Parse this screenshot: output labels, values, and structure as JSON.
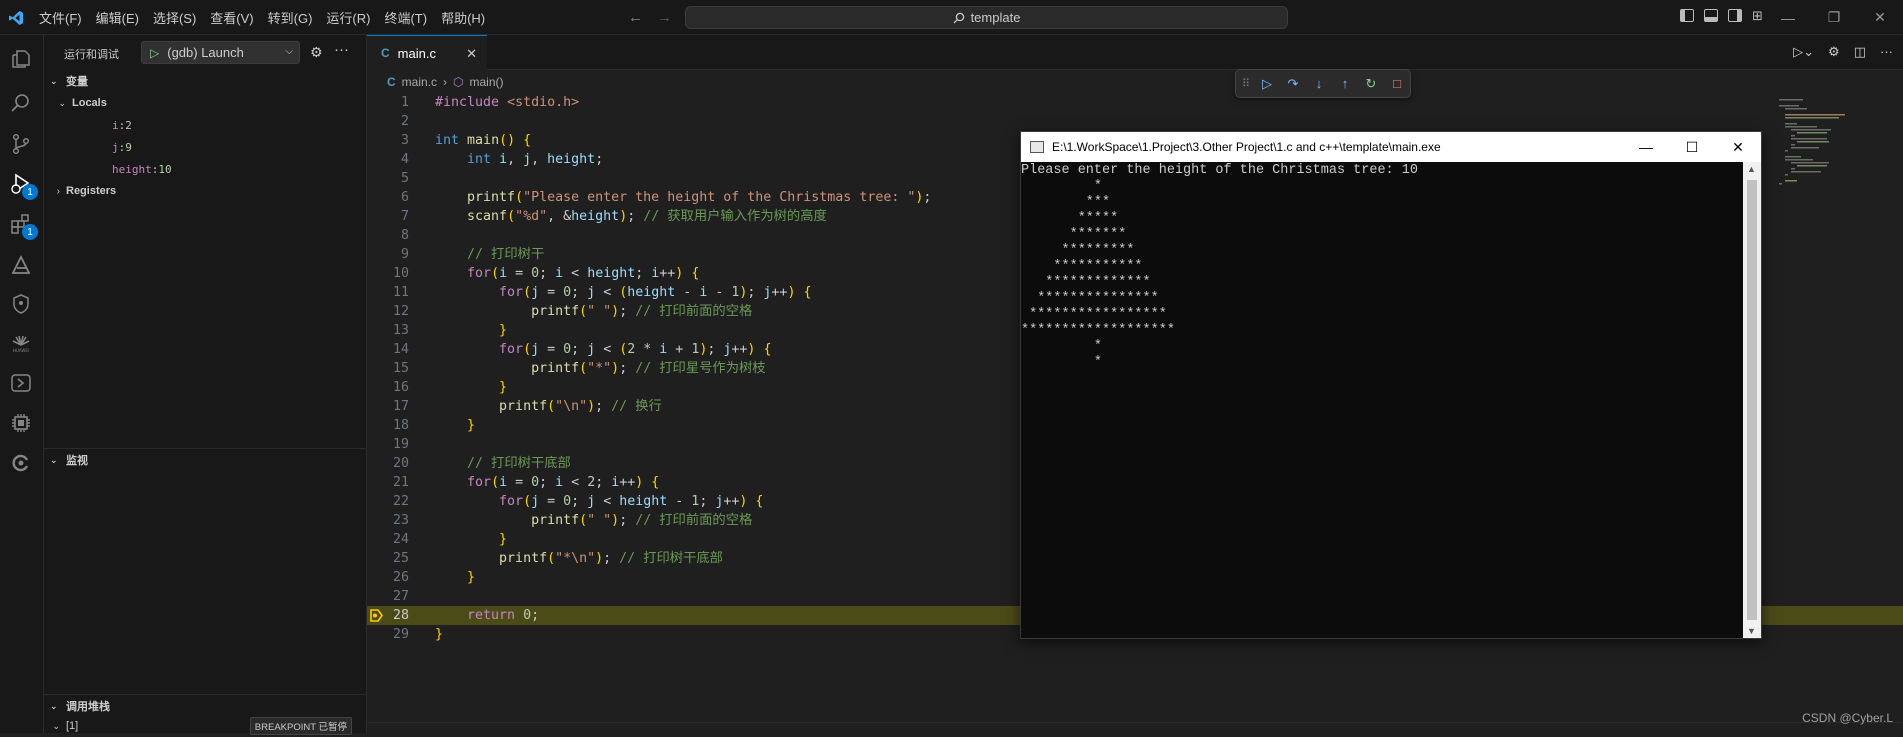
{
  "menu": [
    "文件(F)",
    "编辑(E)",
    "选择(S)",
    "查看(V)",
    "转到(G)",
    "运行(R)",
    "终端(T)",
    "帮助(H)"
  ],
  "search": {
    "text": "template"
  },
  "sidebar": {
    "title": "运行和调试",
    "launch_config": "(gdb) Launch",
    "variables_title": "变量",
    "locals_label": "Locals",
    "locals": [
      {
        "name": "i",
        "value": "2"
      },
      {
        "name": "j",
        "value": "9"
      },
      {
        "name": "height",
        "value": "10"
      }
    ],
    "registers_label": "Registers",
    "watch_title": "监视",
    "callstack_title": "调用堆栈",
    "callstack_item": "[1]",
    "breakpoint_badge": "BREAKPOINT 已暂停"
  },
  "activity_badges": {
    "debug": "1",
    "extensions": "1"
  },
  "editor": {
    "tab_label": "main.c",
    "tab_icon": "C",
    "breadcrumb_file": "main.c",
    "breadcrumb_func": "main()",
    "current_line": 28,
    "lines": [
      "#include <stdio.h>",
      "",
      "int main() {",
      "    int i, j, height;",
      "",
      "    printf(\"Please enter the height of the Christmas tree: \");",
      "    scanf(\"%d\", &height); // 获取用户输入作为树的高度",
      "",
      "    // 打印树干",
      "    for(i = 0; i < height; i++) {",
      "        for(j = 0; j < (height - i - 1); j++) {",
      "            printf(\" \"); // 打印前面的空格",
      "        }",
      "        for(j = 0; j < (2 * i + 1); j++) {",
      "            printf(\"*\"); // 打印星号作为树枝",
      "        }",
      "        printf(\"\\n\"); // 换行",
      "    }",
      "",
      "    // 打印树干底部",
      "    for(i = 0; i < 2; i++) {",
      "        for(j = 0; j < height - 1; j++) {",
      "            printf(\" \"); // 打印前面的空格",
      "        }",
      "        printf(\"*\\n\"); // 打印树干底部",
      "    }",
      "",
      "    return 0;",
      "}"
    ]
  },
  "console": {
    "title": "E:\\1.WorkSpace\\1.Project\\3.Other Project\\1.c and c++\\template\\main.exe",
    "output": [
      "Please enter the height of the Christmas tree: 10",
      "         *",
      "        ***",
      "       *****",
      "      *******",
      "     *********",
      "    ***********",
      "   *************",
      "  ***************",
      " *****************",
      "*******************",
      "         *",
      "         *"
    ]
  },
  "watermark": "CSDN @Cyber.L",
  "colors": {
    "accent": "#0078d4",
    "keyword": "#569cd6",
    "control": "#c586c0",
    "string": "#ce9178",
    "comment": "#6a9955",
    "function": "#dcdcaa",
    "number": "#b5cea8",
    "variable": "#9cdcfe",
    "current_line": "#4b4b18"
  }
}
